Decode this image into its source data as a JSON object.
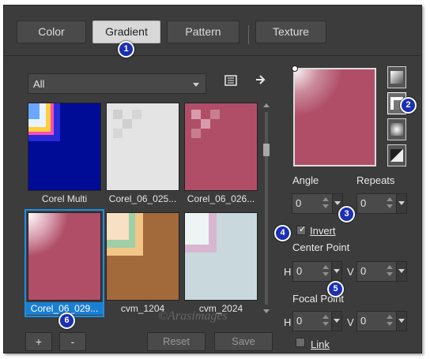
{
  "tabs": [
    {
      "label": "Color",
      "active": false
    },
    {
      "label": "Gradient",
      "active": true
    },
    {
      "label": "Pattern",
      "active": false
    },
    {
      "label": "Texture",
      "active": false
    }
  ],
  "filter": {
    "selected": "All"
  },
  "toolbar_icons": [
    "gradient-editor-icon",
    "arrow-right-icon"
  ],
  "gradients": [
    {
      "name": "Corel Multi",
      "selected": false
    },
    {
      "name": "Corel_06_025...",
      "selected": false
    },
    {
      "name": "Corel_06_026...",
      "selected": false
    },
    {
      "name": "Corel_06_029...",
      "selected": true
    },
    {
      "name": "cvm_1204",
      "selected": false
    },
    {
      "name": "cvm_2024",
      "selected": false
    }
  ],
  "list_buttons": {
    "add": "+",
    "remove": "-"
  },
  "actions": {
    "reset": "Reset",
    "save": "Save"
  },
  "labels": {
    "angle": "Angle",
    "repeats": "Repeats",
    "invert": "Invert",
    "center_point": "Center Point",
    "focal_point": "Focal Point",
    "h": "H",
    "v": "V",
    "link": "Link"
  },
  "values": {
    "angle": "0",
    "repeats": "0",
    "center_h": "0",
    "center_v": "0",
    "focal_h": "0",
    "focal_v": "0"
  },
  "invert_checked": true,
  "link_checked": false,
  "gradient_types": [
    "linear-gradient-type-icon",
    "rectangular-gradient-type-icon",
    "radial-gradient-type-icon",
    "corner-gradient-type-icon"
  ],
  "badges": [
    "1",
    "2",
    "3",
    "4",
    "5",
    "6"
  ],
  "watermark": "©Arasimages",
  "colors": {
    "accent": "#1a7fd4",
    "badge": "#1d2fb2",
    "rose": "#b04e68"
  }
}
